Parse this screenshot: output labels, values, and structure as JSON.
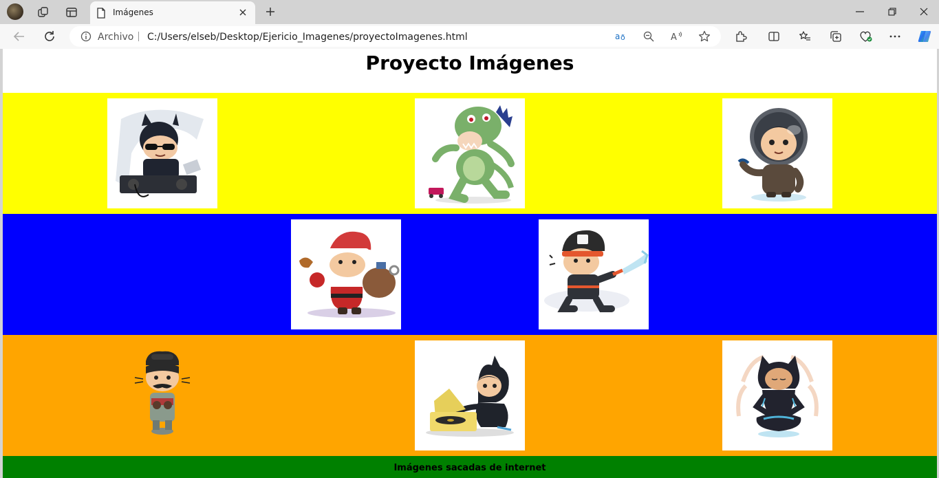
{
  "browser": {
    "tab": {
      "title": "Imágenes"
    },
    "address": {
      "origin_label": "Archivo",
      "url": "C:/Users/elseb/Desktop/Ejericio_Imagenes/proyectoImagenes.html"
    }
  },
  "page": {
    "title": "Proyecto Imágenes",
    "footer": "Imágenes sacadas de internet",
    "colors": {
      "row1": "#ffff00",
      "row2": "#0000ff",
      "row3": "#ffa500",
      "footer": "#008000"
    },
    "rows": [
      {
        "images": [
          "octocat-dj",
          "octocat-dinosaur",
          "octocat-astronaut"
        ]
      },
      {
        "images": [
          "octocat-santa",
          "octocat-firefighter"
        ]
      },
      {
        "images": [
          "octocat-mustache-figure",
          "octocat-record-player",
          "octocat-meditating"
        ]
      }
    ]
  }
}
